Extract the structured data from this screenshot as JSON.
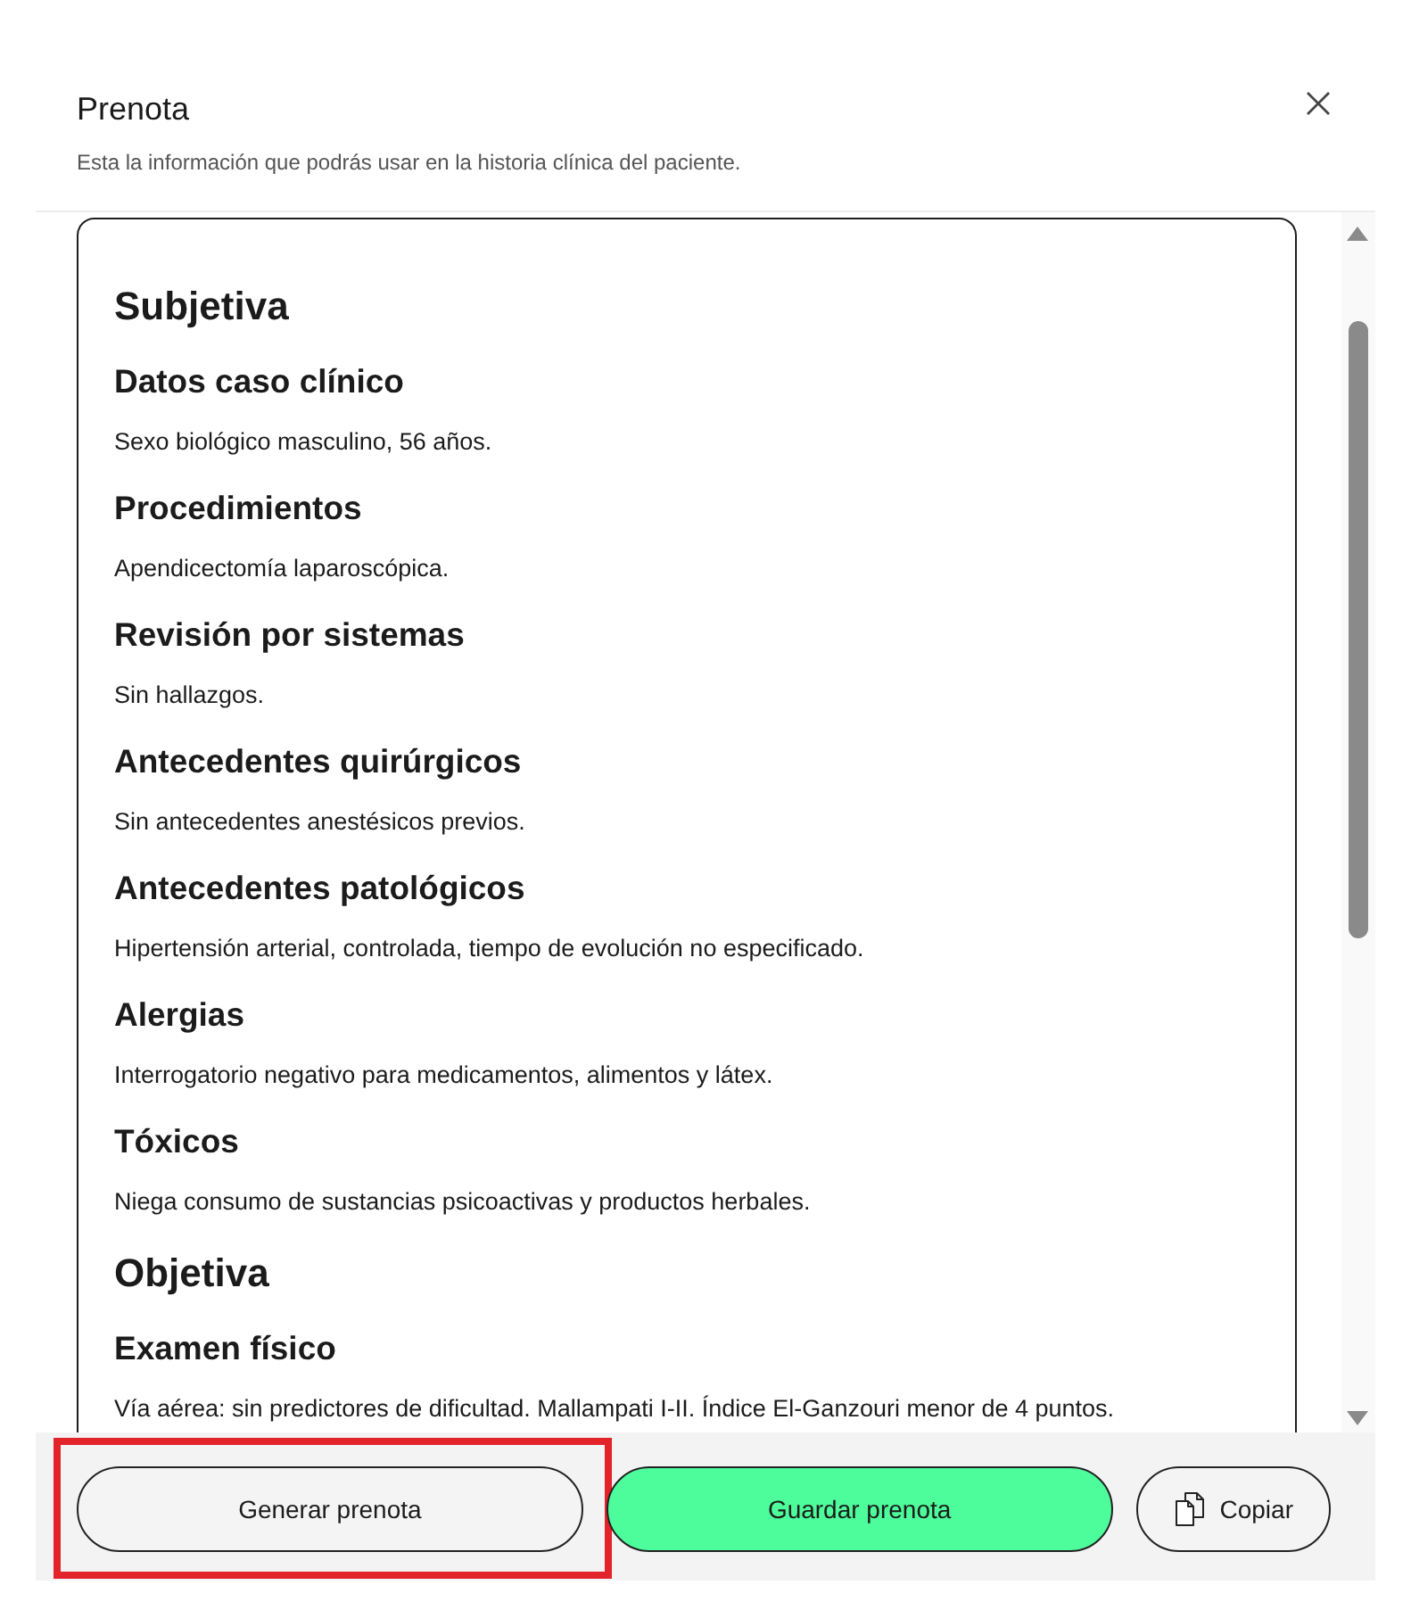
{
  "dialog": {
    "title": "Prenota",
    "subtitle": "Esta la información que podrás usar en la historia clínica del paciente."
  },
  "note": {
    "blocks": [
      {
        "kind": "section",
        "text": "Subjetiva"
      },
      {
        "kind": "heading",
        "text": "Datos caso clínico"
      },
      {
        "kind": "paragraph",
        "text": "Sexo biológico masculino, 56 años."
      },
      {
        "kind": "heading",
        "text": "Procedimientos"
      },
      {
        "kind": "paragraph",
        "text": "Apendicectomía laparoscópica."
      },
      {
        "kind": "heading",
        "text": "Revisión por sistemas"
      },
      {
        "kind": "paragraph",
        "text": "Sin hallazgos."
      },
      {
        "kind": "heading",
        "text": "Antecedentes quirúrgicos"
      },
      {
        "kind": "paragraph",
        "text": "Sin antecedentes anestésicos previos."
      },
      {
        "kind": "heading",
        "text": "Antecedentes patológicos"
      },
      {
        "kind": "paragraph",
        "text": "Hipertensión arterial, controlada, tiempo de evolución no especificado."
      },
      {
        "kind": "heading",
        "text": "Alergias"
      },
      {
        "kind": "paragraph",
        "text": "Interrogatorio negativo para medicamentos, alimentos y látex."
      },
      {
        "kind": "heading",
        "text": "Tóxicos"
      },
      {
        "kind": "paragraph",
        "text": "Niega consumo de sustancias psicoactivas y productos herbales."
      },
      {
        "kind": "section",
        "text": "Objetiva"
      },
      {
        "kind": "heading",
        "text": "Examen físico"
      },
      {
        "kind": "paragraph",
        "text": "Vía aérea: sin predictores de dificultad. Mallampati I-II. Índice El-Ganzouri menor de 4 puntos."
      }
    ]
  },
  "buttons": [
    {
      "kind": "outline",
      "label": "Generar prenota",
      "highlighted": true
    },
    {
      "kind": "primary",
      "label": "Guardar prenota",
      "highlighted": false
    },
    {
      "kind": "outline-icon",
      "label": "Copiar",
      "highlighted": false
    }
  ]
}
